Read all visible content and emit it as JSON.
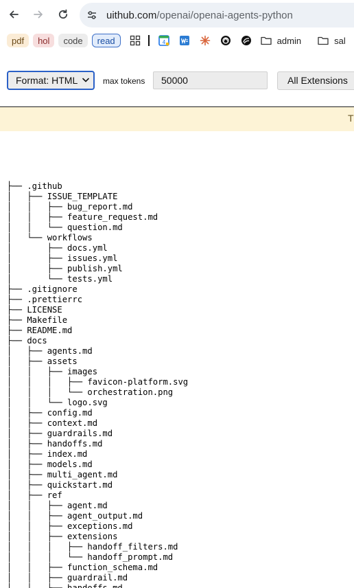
{
  "browser": {
    "url_host": "uithub.com",
    "url_path": "/openai/openai-agents-python",
    "back_icon": "arrow-left-icon",
    "forward_icon": "arrow-right-icon",
    "reload_icon": "reload-icon",
    "site_info_icon": "tune-icon"
  },
  "bookmarks": {
    "pdf": "pdf",
    "hol": "hol",
    "code": "code",
    "read": "read",
    "admin": "admin",
    "sal": "sal"
  },
  "toolbar": {
    "format_value": "Format: HTML",
    "max_tokens_label": "max tokens",
    "max_tokens_value": "50000",
    "extensions_label": "All Extensions"
  },
  "notice": {
    "text": "T"
  },
  "tree": [
    "├── .github",
    "│   ├── ISSUE_TEMPLATE",
    "│   │   ├── bug_report.md",
    "│   │   ├── feature_request.md",
    "│   │   └── question.md",
    "│   └── workflows",
    "│       ├── docs.yml",
    "│       ├── issues.yml",
    "│       ├── publish.yml",
    "│       └── tests.yml",
    "├── .gitignore",
    "├── .prettierrc",
    "├── LICENSE",
    "├── Makefile",
    "├── README.md",
    "├── docs",
    "│   ├── agents.md",
    "│   ├── assets",
    "│   │   ├── images",
    "│   │   │   ├── favicon-platform.svg",
    "│   │   │   └── orchestration.png",
    "│   │   └── logo.svg",
    "│   ├── config.md",
    "│   ├── context.md",
    "│   ├── guardrails.md",
    "│   ├── handoffs.md",
    "│   ├── index.md",
    "│   ├── models.md",
    "│   ├── multi_agent.md",
    "│   ├── quickstart.md",
    "│   ├── ref",
    "│   │   ├── agent.md",
    "│   │   ├── agent_output.md",
    "│   │   ├── exceptions.md",
    "│   │   ├── extensions",
    "│   │   │   ├── handoff_filters.md",
    "│   │   │   └── handoff_prompt.md",
    "│   │   ├── function_schema.md",
    "│   │   ├── guardrail.md",
    "│   │   ├── handoffs.md"
  ]
}
